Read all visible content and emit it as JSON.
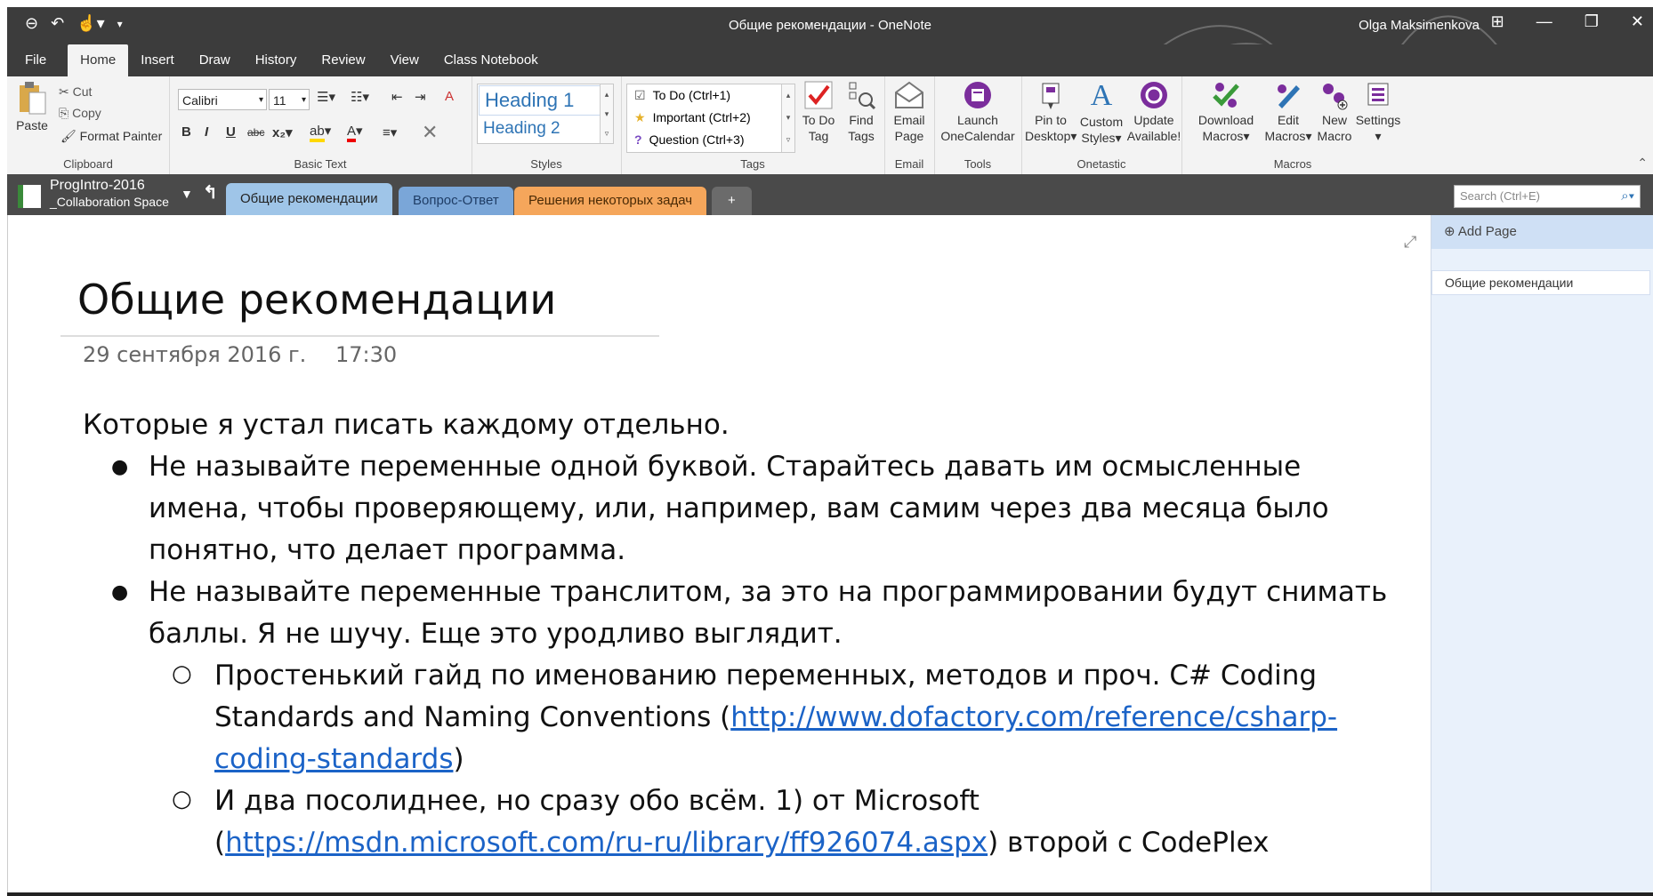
{
  "window": {
    "title": "Общие рекомендации  -  OneNote",
    "user": "Olga Maksimenkova"
  },
  "menu_tabs": [
    "File",
    "Home",
    "Insert",
    "Draw",
    "History",
    "Review",
    "View",
    "Class Notebook"
  ],
  "ribbon": {
    "clipboard": {
      "paste": "Paste",
      "cut": "Cut",
      "copy": "Copy",
      "format_painter": "Format Painter",
      "label": "Clipboard"
    },
    "basic_text": {
      "font": "Calibri",
      "size": "11",
      "label": "Basic Text"
    },
    "styles": {
      "h1": "Heading 1",
      "h2": "Heading 2",
      "label": "Styles"
    },
    "tags": {
      "todo": "To Do (Ctrl+1)",
      "important": "Important (Ctrl+2)",
      "question": "Question (Ctrl+3)",
      "todo_tag_1": "To Do",
      "todo_tag_2": "Tag",
      "find_1": "Find",
      "find_2": "Tags",
      "label": "Tags"
    },
    "email": {
      "l1": "Email",
      "l2": "Page",
      "label": "Email"
    },
    "tools": {
      "l1": "Launch",
      "l2": "OneCalendar",
      "label": "Tools"
    },
    "onetastic": {
      "pin1": "Pin to",
      "pin2": "Desktop",
      "custom1": "Custom",
      "custom2": "Styles",
      "update1": "Update",
      "update2": "Available!",
      "label": "Onetastic"
    },
    "macros": {
      "dl1": "Download",
      "dl2": "Macros",
      "edit1": "Edit",
      "edit2": "Macros",
      "new1": "New",
      "new2": "Macro",
      "settings": "Settings",
      "label": "Macros"
    }
  },
  "notebook": {
    "name": "ProgIntro-2016",
    "section_group": "_Collaboration Space"
  },
  "section_tabs": [
    "Общие рекомендации",
    "Вопрос-Ответ",
    "Решения некоторых задач",
    "+"
  ],
  "search_placeholder": "Search (Ctrl+E)",
  "page": {
    "title": "Общие рекомендации",
    "date": "29 сентября 2016 г.",
    "time": "17:30",
    "intro": "Которые я устал писать каждому отдельно.",
    "b1": "Не называйте переменные одной буквой. Старайтесь давать им осмысленные имена, чтобы проверяющему, или, например, вам самим через два месяца было понятно, что делает программа.",
    "b2": "Не называйте переменные транслитом, за это на программировании будут снимать баллы. Я не шучу. Еще это уродливо выглядит.",
    "s1_pre": "Простенький гайд по именованию переменных, методов и проч. C# Coding Standards and Naming Conventions (",
    "s1_link": "http://www.dofactory.com/reference/csharp-coding-standards",
    "s1_post": ")",
    "s2_pre": "И два посолиднее, но сразу обо всём. 1) от Microsoft (",
    "s2_link": "https://msdn.microsoft.com/ru-ru/library/ff926074.aspx",
    "s2_post": ") второй с CodePlex"
  },
  "pages_pane": {
    "add_page": "Add Page",
    "page_item": "Общие рекомендации"
  },
  "colors": {
    "accent_blue": "#1b63c7",
    "section1": "#9fc5e8",
    "section2": "#7aa6d8",
    "section3": "#f5a65b"
  }
}
